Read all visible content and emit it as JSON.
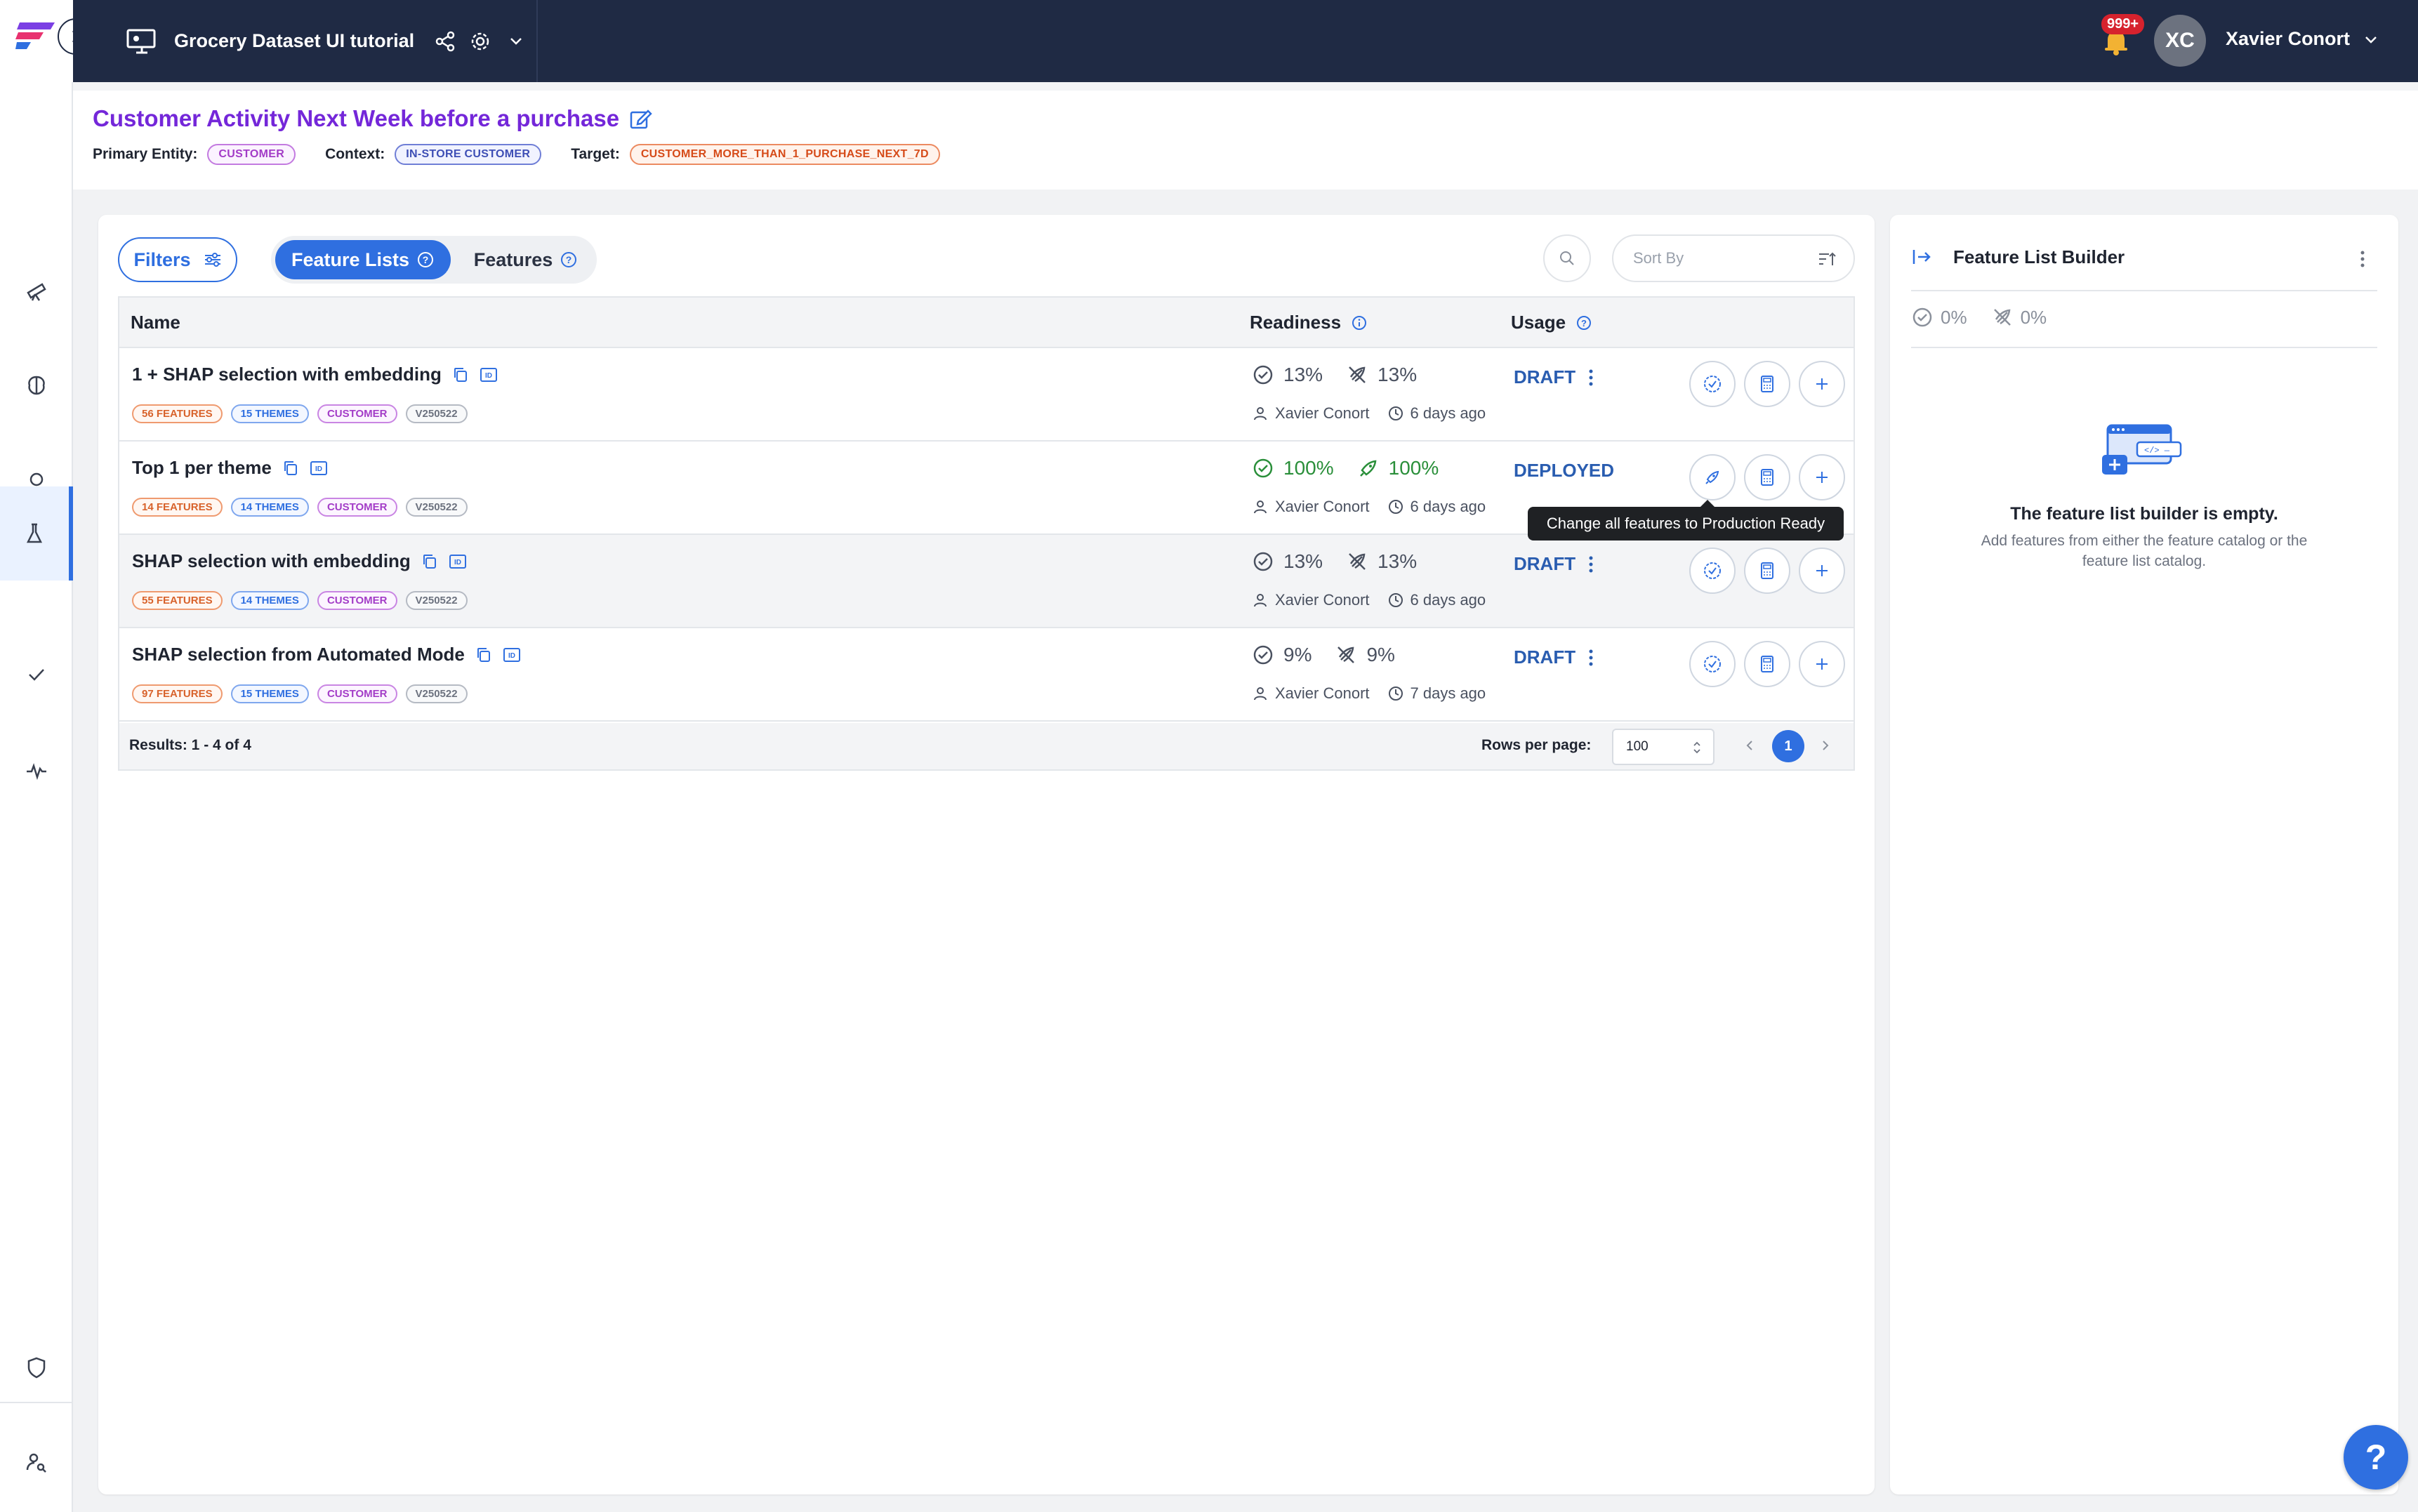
{
  "topbar": {
    "project_title": "Grocery Dataset UI tutorial",
    "notification_badge": "999+",
    "user_initials": "XC",
    "user_name": "Xavier Conort"
  },
  "header": {
    "title": "Customer Activity Next Week before a purchase",
    "primary_entity_label": "Primary Entity:",
    "primary_entity_value": "CUSTOMER",
    "context_label": "Context:",
    "context_value": "IN-STORE CUSTOMER",
    "target_label": "Target:",
    "target_value": "CUSTOMER_MORE_THAN_1_PURCHASE_NEXT_7D"
  },
  "toolbar": {
    "filters_label": "Filters",
    "tab_feature_lists": "Feature Lists",
    "tab_features": "Features",
    "sort_placeholder": "Sort By"
  },
  "table": {
    "headers": {
      "name": "Name",
      "readiness": "Readiness",
      "usage": "Usage"
    },
    "rows": [
      {
        "name": "1 + SHAP selection with embedding",
        "tags": [
          "56 FEATURES",
          "15 THEMES",
          "CUSTOMER",
          "V250522"
        ],
        "readiness": "13%",
        "production": "13%",
        "owner": "Xavier Conort",
        "age": "6 days ago",
        "usage": "DRAFT"
      },
      {
        "name": "Top 1 per theme",
        "tags": [
          "14 FEATURES",
          "14 THEMES",
          "CUSTOMER",
          "V250522"
        ],
        "readiness": "100%",
        "production": "100%",
        "owner": "Xavier Conort",
        "age": "6 days ago",
        "usage": "DEPLOYED"
      },
      {
        "name": "SHAP selection with embedding",
        "tags": [
          "55 FEATURES",
          "14 THEMES",
          "CUSTOMER",
          "V250522"
        ],
        "readiness": "13%",
        "production": "13%",
        "owner": "Xavier Conort",
        "age": "6 days ago",
        "usage": "DRAFT"
      },
      {
        "name": "SHAP selection from Automated Mode",
        "tags": [
          "97 FEATURES",
          "15 THEMES",
          "CUSTOMER",
          "V250522"
        ],
        "readiness": "9%",
        "production": "9%",
        "owner": "Xavier Conort",
        "age": "7 days ago",
        "usage": "DRAFT"
      }
    ],
    "footer": {
      "results": "Results: 1 - 4 of 4",
      "rows_per_page_label": "Rows per page:",
      "rows_per_page_value": "100",
      "current_page": "1"
    }
  },
  "tooltip": "Change all features to Production Ready",
  "builder": {
    "title": "Feature List Builder",
    "readiness": "0%",
    "production": "0%",
    "empty_title": "The feature list builder is empty.",
    "empty_subtitle": "Add features from either the feature catalog or the feature list catalog."
  },
  "help_label": "?",
  "colors": {
    "accent": "#2f6fe0",
    "title_purple": "#7427d9",
    "topbar": "#1f2a44",
    "green": "#2a8f3a"
  }
}
